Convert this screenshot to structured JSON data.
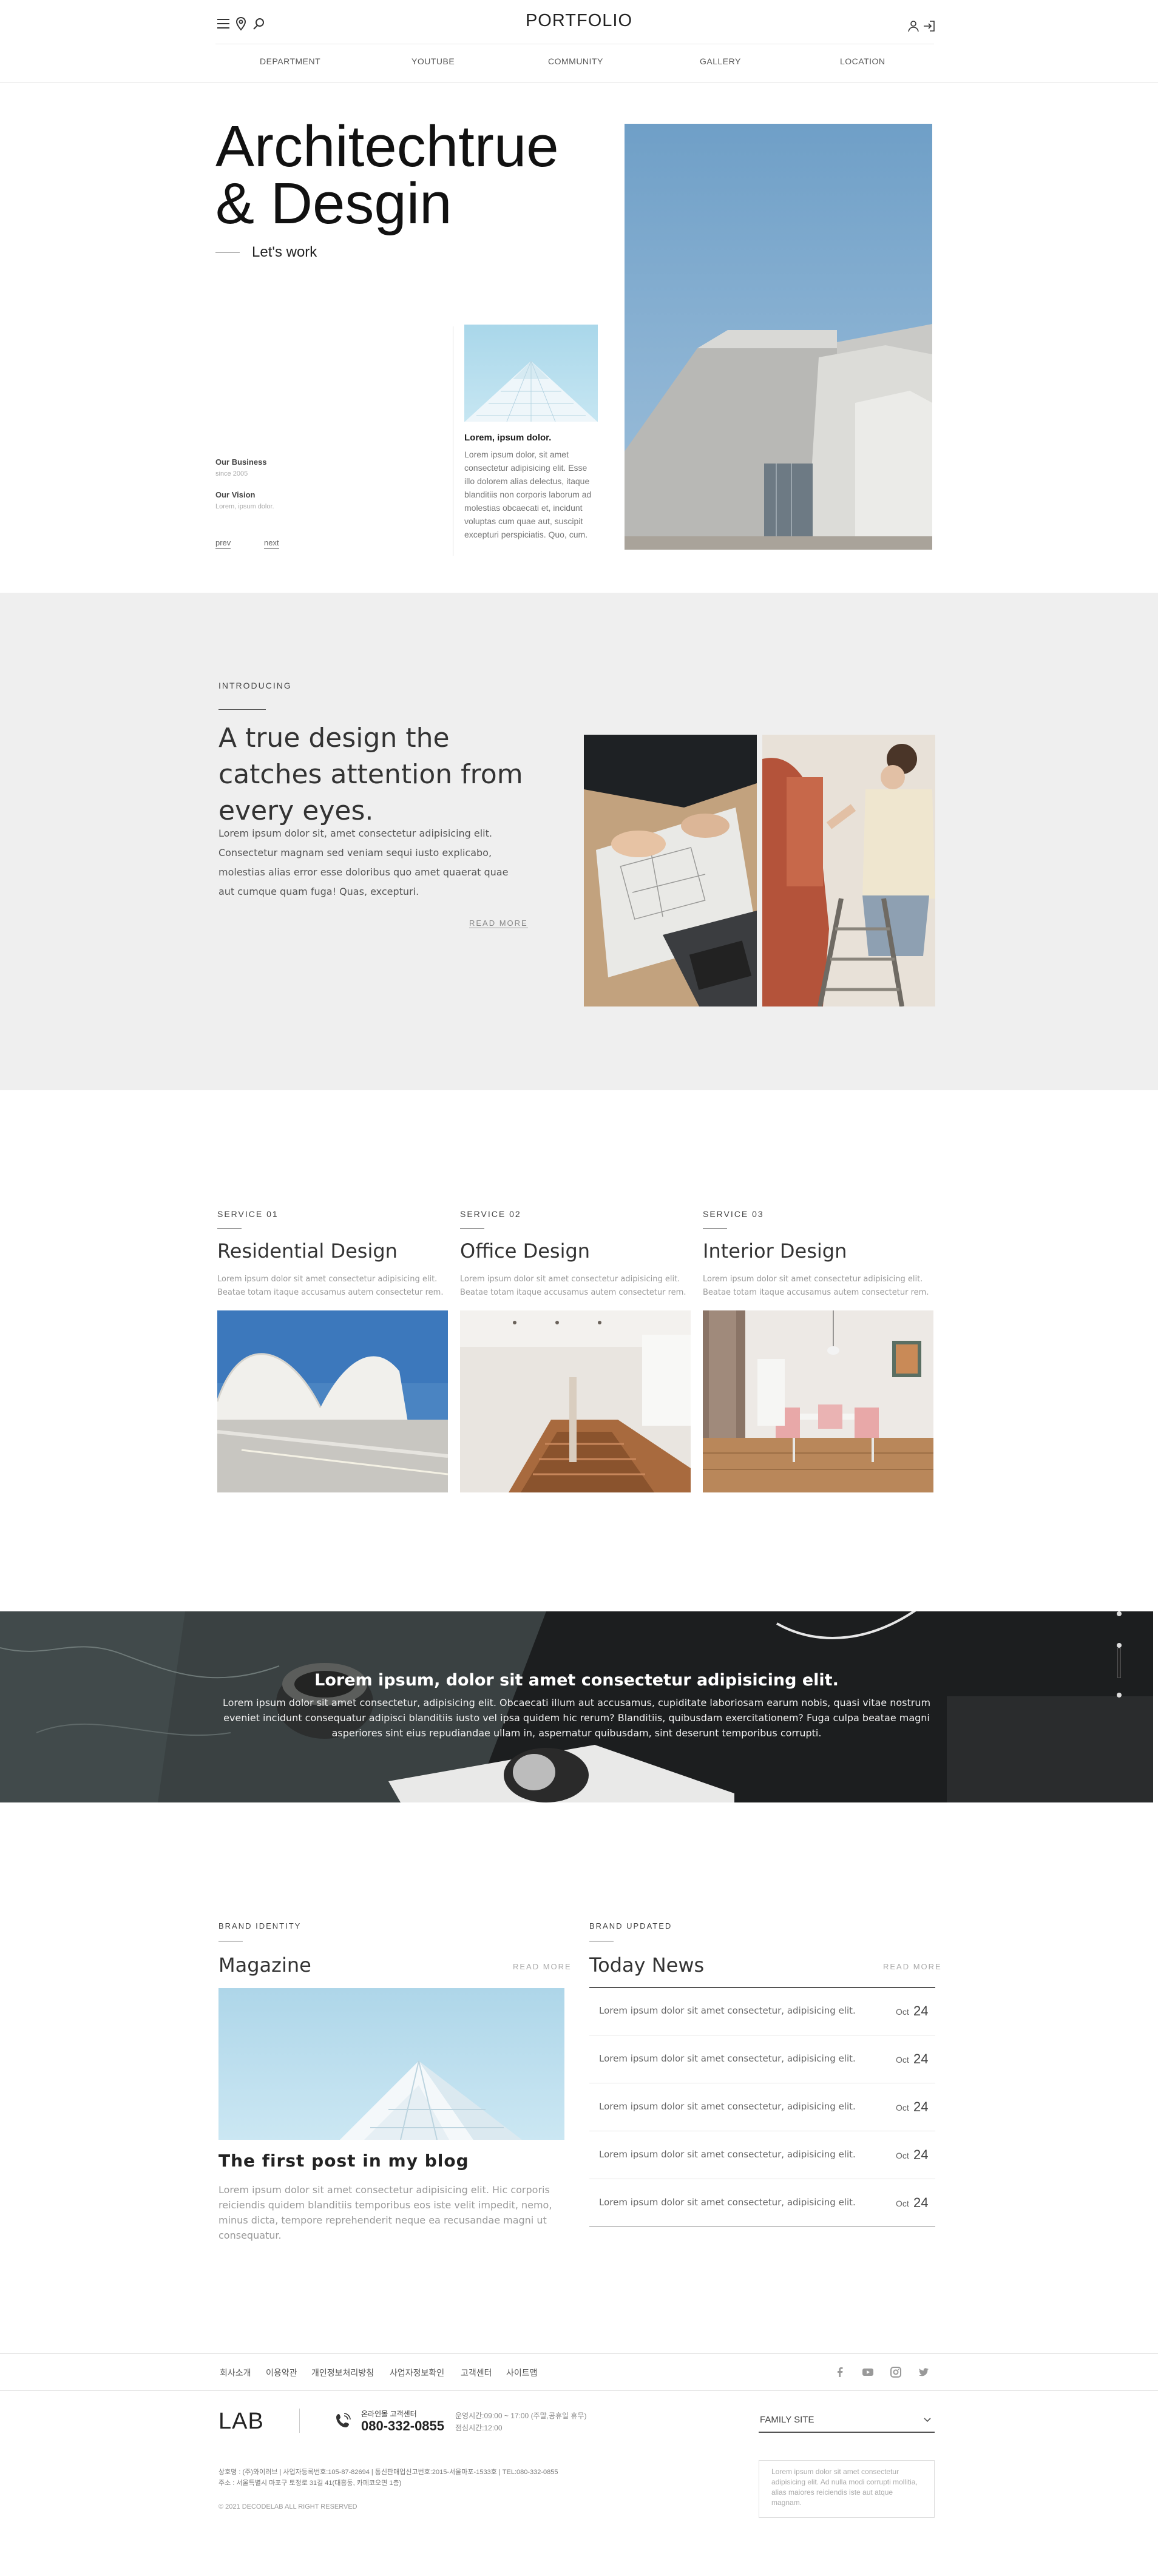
{
  "header": {
    "logo": "PORTFOLIO",
    "nav": [
      "DEPARTMENT",
      "YOUTUBE",
      "COMMUNITY",
      "GALLERY",
      "LOCATION"
    ]
  },
  "hero": {
    "title_line1": "Architechtrue",
    "title_line2": "& Desgin",
    "subtitle": "Let's work",
    "business_label": "Our Business",
    "business_since": "since 2005",
    "vision_label": "Our Vision",
    "vision_text": "Lorem, ipsum dolor.",
    "prev_label": "prev",
    "next_label": "next",
    "card_title": "Lorem, ipsum dolor.",
    "card_text": "Lorem ipsum dolor, sit amet consectetur adipisicing elit. Esse illo dolorem alias delectus, itaque blanditiis non corporis laborum ad molestias obcaecati et, incidunt voluptas cum quae aut, suscipit excepturi perspiciatis. Quo, cum."
  },
  "intro": {
    "eyebrow": "INTRODUCING",
    "headline": "A true design the catches attention from every eyes.",
    "body": "Lorem ipsum dolor sit, amet consectetur adipisicing elit. Consectetur magnam sed veniam sequi iusto explicabo, molestias alias error esse doloribus quo amet quaerat quae aut cumque quam fuga! Quas, excepturi.",
    "read_more": "READ MORE"
  },
  "services": [
    {
      "eyebrow": "SERVICE 01",
      "title": "Residential Design",
      "text": "Lorem ipsum dolor sit amet consectetur adipisicing elit. Beatae totam itaque accusamus autem consectetur rem."
    },
    {
      "eyebrow": "SERVICE 02",
      "title": "Office Design",
      "text": "Lorem ipsum dolor sit amet consectetur adipisicing elit. Beatae totam itaque accusamus autem consectetur rem."
    },
    {
      "eyebrow": "SERVICE 03",
      "title": "Interior Design",
      "text": "Lorem ipsum dolor sit amet consectetur adipisicing elit. Beatae totam itaque accusamus autem consectetur rem."
    }
  ],
  "banner": {
    "title": "Lorem ipsum, dolor sit amet consectetur adipisicing elit.",
    "text": "Lorem ipsum dolor sit amet consectetur, adipisicing elit. Obcaecati illum aut accusamus, cupiditate laboriosam earum nobis, quasi vitae nostrum eveniet incidunt consequatur adipisci blanditiis iusto vel ipsa quidem hic rerum? Blanditiis, quibusdam exercitationem? Fuga culpa beatae magni asperiores sint eius repudiandae ullam in, aspernatur quibusdam, sint deserunt temporibus corrupti."
  },
  "magazine": {
    "eyebrow": "BRAND IDENTITY",
    "title": "Magazine",
    "read_more": "READ MORE",
    "post_title": "The first post in my blog",
    "post_text": "Lorem ipsum dolor sit amet consectetur adipisicing elit. Hic corporis reiciendis quidem blanditiis temporibus eos iste velit impedit, nemo, minus dicta, tempore reprehenderit neque ea recusandae magni ut consequatur."
  },
  "news": {
    "eyebrow": "BRAND UPDATED",
    "title": "Today News",
    "read_more": "READ MORE",
    "items": [
      {
        "text": "Lorem ipsum dolor sit amet consectetur, adipisicing elit.",
        "month": "Oct",
        "day": "24"
      },
      {
        "text": "Lorem ipsum dolor sit amet consectetur, adipisicing elit.",
        "month": "Oct",
        "day": "24"
      },
      {
        "text": "Lorem ipsum dolor sit amet consectetur, adipisicing elit.",
        "month": "Oct",
        "day": "24"
      },
      {
        "text": "Lorem ipsum dolor sit amet consectetur, adipisicing elit.",
        "month": "Oct",
        "day": "24"
      },
      {
        "text": "Lorem ipsum dolor sit amet consectetur, adipisicing elit.",
        "month": "Oct",
        "day": "24"
      }
    ]
  },
  "footer": {
    "links": [
      "회사소개",
      "이용약관",
      "개인정보처리방침",
      "사업자정보확인",
      "고객센터",
      "사이트맵"
    ],
    "social_icons": [
      "facebook-icon",
      "youtube-icon",
      "instagram-icon",
      "twitter-icon"
    ],
    "logo": "LAB",
    "cs_label": "온라인몰 고객센터",
    "phone": "080-332-0855",
    "hours_line1": "운영시간:09:00 ~ 17:00 (주말,공휴일 휴무)",
    "hours_line2": "점심시간:12:00",
    "family_site": "FAMILY SITE",
    "family_text": "Lorem ipsum dolor sit amet consectetur adipisicing elit. Ad nulla modi corrupti mollitia, alias maiores reiciendis iste aut atque magnam.",
    "info_line1": "상호명 : (주)와이러브 | 사업자등록번호:105-87-82694 | 통신판매업신고번호:2015-서울마포-1533호 | TEL:080-332-0855",
    "info_line2": "주소 : 서울특별시 마포구 토정로 31길 41(대흥동, 카페코오면 1층)",
    "copyright": "© 2021 DECODELAB ALL RIGHT RESERVED"
  },
  "colors": {
    "intro_bg": "#efefef",
    "banner_bg": "#1d1f20",
    "sky": "#6f9fc7",
    "text_dark": "#222222"
  }
}
